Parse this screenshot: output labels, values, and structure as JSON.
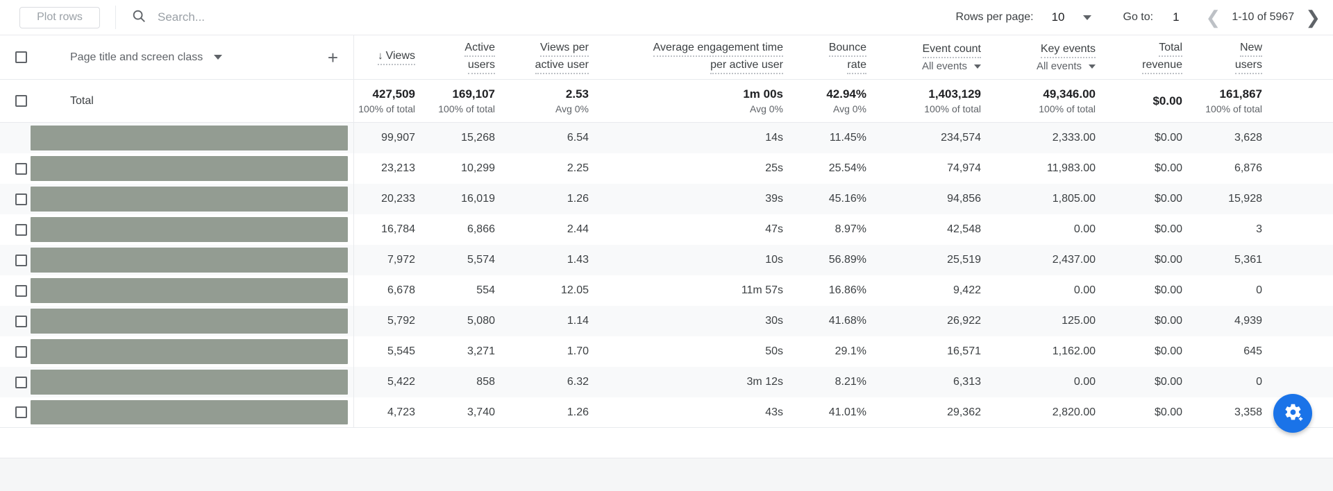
{
  "toolbar": {
    "plot_rows_label": "Plot rows",
    "search_icon": "search-icon",
    "search_value": "",
    "search_placeholder": "Search...",
    "rows_per_page_label": "Rows per page:",
    "rows_per_page_value": "10",
    "goto_label": "Go to:",
    "goto_value": "1",
    "prev_icon": "chevron-left-icon",
    "next_icon": "chevron-right-icon",
    "range_label": "1-10 of 5967"
  },
  "table": {
    "dimension_header": "Page title and screen class",
    "add_column_icon": "plus-icon",
    "sort_indicator": "↓",
    "columns": [
      {
        "line1": "Views",
        "line2": "",
        "sub": "",
        "sorted": true
      },
      {
        "line1": "Active",
        "line2": "users",
        "sub": ""
      },
      {
        "line1": "Views per",
        "line2": "active user",
        "sub": ""
      },
      {
        "line1": "Average engagement time",
        "line2": "per active user",
        "sub": ""
      },
      {
        "line1": "Bounce",
        "line2": "rate",
        "sub": ""
      },
      {
        "line1": "Event count",
        "line2": "",
        "sub": "All events"
      },
      {
        "line1": "Key events",
        "line2": "",
        "sub": "All events"
      },
      {
        "line1": "Total",
        "line2": "revenue",
        "sub": ""
      },
      {
        "line1": "New",
        "line2": "users",
        "sub": ""
      }
    ],
    "total_row": {
      "label": "Total",
      "values": [
        "427,509",
        "169,107",
        "2.53",
        "1m 00s",
        "42.94%",
        "1,403,129",
        "49,346.00",
        "$0.00",
        "161,867"
      ],
      "subs": [
        "100% of total",
        "100% of total",
        "Avg 0%",
        "Avg 0%",
        "Avg 0%",
        "100% of total",
        "100% of total",
        "",
        "100% of total"
      ]
    },
    "rows": [
      {
        "dimension": "",
        "redacted": true,
        "checkbox": false,
        "values": [
          "99,907",
          "15,268",
          "6.54",
          "14s",
          "11.45%",
          "234,574",
          "2,333.00",
          "$0.00",
          "3,628"
        ]
      },
      {
        "dimension": "",
        "redacted": true,
        "checkbox": true,
        "values": [
          "23,213",
          "10,299",
          "2.25",
          "25s",
          "25.54%",
          "74,974",
          "11,983.00",
          "$0.00",
          "6,876"
        ]
      },
      {
        "dimension": "",
        "redacted": true,
        "checkbox": true,
        "values": [
          "20,233",
          "16,019",
          "1.26",
          "39s",
          "45.16%",
          "94,856",
          "1,805.00",
          "$0.00",
          "15,928"
        ]
      },
      {
        "dimension": "",
        "redacted": true,
        "checkbox": true,
        "values": [
          "16,784",
          "6,866",
          "2.44",
          "47s",
          "8.97%",
          "42,548",
          "0.00",
          "$0.00",
          "3"
        ]
      },
      {
        "dimension": "",
        "redacted": true,
        "checkbox": true,
        "values": [
          "7,972",
          "5,574",
          "1.43",
          "10s",
          "56.89%",
          "25,519",
          "2,437.00",
          "$0.00",
          "5,361"
        ]
      },
      {
        "dimension": "",
        "redacted": true,
        "checkbox": true,
        "values": [
          "6,678",
          "554",
          "12.05",
          "11m 57s",
          "16.86%",
          "9,422",
          "0.00",
          "$0.00",
          "0"
        ]
      },
      {
        "dimension": "",
        "redacted": true,
        "checkbox": true,
        "values": [
          "5,792",
          "5,080",
          "1.14",
          "30s",
          "41.68%",
          "26,922",
          "125.00",
          "$0.00",
          "4,939"
        ]
      },
      {
        "dimension": "",
        "redacted": true,
        "checkbox": true,
        "values": [
          "5,545",
          "3,271",
          "1.70",
          "50s",
          "29.1%",
          "16,571",
          "1,162.00",
          "$0.00",
          "645"
        ]
      },
      {
        "dimension": "",
        "redacted": true,
        "checkbox": true,
        "values": [
          "5,422",
          "858",
          "6.32",
          "3m 12s",
          "8.21%",
          "6,313",
          "0.00",
          "$0.00",
          "0"
        ]
      },
      {
        "dimension": "",
        "redacted": true,
        "checkbox": true,
        "values": [
          "4,723",
          "3,740",
          "1.26",
          "43s",
          "41.01%",
          "29,362",
          "2,820.00",
          "$0.00",
          "3,358"
        ]
      }
    ]
  },
  "fab": {
    "icon": "insights-gear-icon",
    "color": "#1a73e8"
  }
}
